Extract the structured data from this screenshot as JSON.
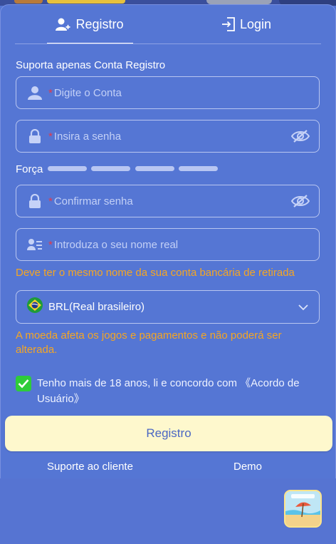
{
  "tabs": {
    "register_label": "Registro",
    "login_label": "Login"
  },
  "form": {
    "support_note": "Suporta apenas Conta Registro",
    "account_placeholder": "Digite o Conta",
    "password_placeholder": "Insira a senha",
    "strength_label": "Força",
    "confirm_placeholder": "Confirmar senha",
    "realname_placeholder": "Introduza o seu nome real",
    "required_mark": "*",
    "realname_warning": "Deve ter o mesmo nome da sua conta bancária de retirada",
    "currency_value": "BRL(Real brasileiro)",
    "currency_warning": "A moeda afeta os jogos e pagamentos e não poderá ser alterada.",
    "agree_text": "Tenho mais de 18 anos, li e concordo com 《Acordo de Usuário》",
    "agree_checked": true
  },
  "actions": {
    "register_button": "Registro",
    "support_link": "Suporte ao cliente",
    "demo_link": "Demo"
  },
  "icons": {
    "register_tab": "add-user-icon",
    "login_tab": "login-icon",
    "account": "user-icon",
    "password": "lock-icon",
    "eye": "eye-off-icon",
    "realname": "id-card-icon",
    "currency": "brazil-flag-icon",
    "dropdown": "chevron-down-icon"
  },
  "colors": {
    "background": "#5576d4",
    "warning": "#f5a623",
    "required": "#e23a4a",
    "checkbox": "#2ecc3a",
    "button_bg": "#fef8cd",
    "button_text": "#4b67c3"
  }
}
